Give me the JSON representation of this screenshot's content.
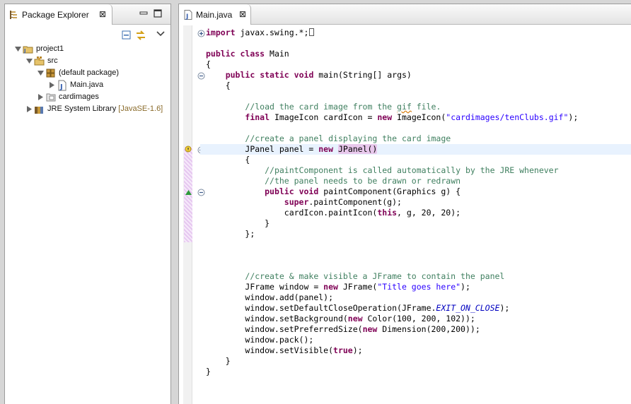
{
  "package_explorer": {
    "tab_label": "Package Explorer",
    "close_glyph": "⊠",
    "icons": {
      "tab": "package-explorer-icon",
      "minimize": "minimize-icon",
      "maximize": "maximize-icon",
      "collapse_all": "collapse-all-icon",
      "link_with_editor": "link-with-editor-icon",
      "view_menu": "view-menu-icon"
    },
    "tree": [
      {
        "label": "project1",
        "icon": "java-project-icon",
        "expanded": true,
        "depth": 0
      },
      {
        "label": "src",
        "icon": "source-folder-icon",
        "expanded": true,
        "depth": 1
      },
      {
        "label": "(default package)",
        "icon": "package-icon",
        "expanded": true,
        "depth": 2
      },
      {
        "label": "Main.java",
        "icon": "java-file-icon",
        "expanded": false,
        "depth": 3
      },
      {
        "label": "cardimages",
        "icon": "folder-icon",
        "expanded": false,
        "depth": 1
      },
      {
        "label": "JRE System Library",
        "decoration": "[JavaSE-1.6]",
        "icon": "library-icon",
        "expanded": false,
        "depth": 0
      }
    ]
  },
  "editor": {
    "tab_label": "Main.java",
    "close_glyph": "⊠",
    "tab_icon": "java-file-icon",
    "code": {
      "l0_import_kw": "import",
      "l0_import_rest": " javax.swing.*;",
      "l1_public": "public",
      "l1_class": "class",
      "l1_name": " Main",
      "l2": "{",
      "l3_public": "public",
      "l3_static": "static",
      "l3_void": "void",
      "l3_rest": " main(String[] args)",
      "l4": "{",
      "l5_comment_a": "//load the card image from the ",
      "l5_comment_gif": "gif",
      "l5_comment_b": " file.",
      "l6_final": "final",
      "l6_mid": " ImageIcon cardIcon = ",
      "l6_new": "new",
      "l6_call": " ImageIcon(",
      "l6_str": "\"cardimages/tenClubs.gif\"",
      "l6_end": ");",
      "l7_comment": "//create a panel displaying the card image",
      "l8_decl": "JPanel panel = ",
      "l8_new": "new",
      "l8_space": " ",
      "l8_call": "JPanel()",
      "l9": "{",
      "l10_comment": "//paintComponent is called automatically by the JRE whenever",
      "l11_comment": "//the panel needs to be drawn or redrawn",
      "l12_public": "public",
      "l12_void": "void",
      "l12_rest": " paintComponent(Graphics g) {",
      "l13_super": "super",
      "l13_rest": ".paintComponent(g);",
      "l14_a": "cardIcon.paintIcon(",
      "l14_this": "this",
      "l14_b": ", g, 20, 20);",
      "l15": "}",
      "l16": "};",
      "l17_comment": "//create & make visible a JFrame to contain the panel",
      "l18_a": "JFrame window = ",
      "l18_new": "new",
      "l18_b": " JFrame(",
      "l18_str": "\"Title goes here\"",
      "l18_c": ");",
      "l19": "window.add(panel);",
      "l20_a": "window.setDefaultCloseOperation(JFrame.",
      "l20_field": "EXIT_ON_CLOSE",
      "l20_b": ");",
      "l21_a": "window.setBackground(",
      "l21_new": "new",
      "l21_b": " Color(100, 200, 102));",
      "l22_a": "window.setPreferredSize(",
      "l22_new": "new",
      "l22_b": " Dimension(200,200));",
      "l23": "window.pack();",
      "l24_a": "window.setVisible(",
      "l24_true": "true",
      "l24_b": ");",
      "l25": "}",
      "l26": "}"
    },
    "gutter_icons": [
      "fold-expand-icon",
      "fold-collapse-icon",
      "quick-fix-warning-icon",
      "override-marker-icon"
    ]
  },
  "colors": {
    "keyword": "#7f0055",
    "comment": "#3f7f5f",
    "string": "#2a00ff",
    "static_field": "#0000c0",
    "current_line": "#e8f2fe",
    "highlight": "#e8c8ec"
  }
}
